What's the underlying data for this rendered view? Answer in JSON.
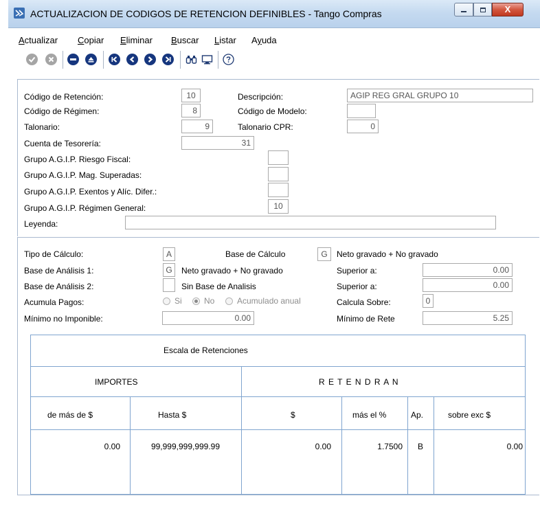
{
  "window": {
    "title": "ACTUALIZACION DE CODIGOS DE RETENCION DEFINIBLES - Tango Compras",
    "minimize_icon": "minimize-icon",
    "maximize_icon": "maximize-icon",
    "close_label": "X"
  },
  "menu": [
    {
      "accel": "A",
      "rest": "ctualizar"
    },
    {
      "accel": "C",
      "rest": "opiar"
    },
    {
      "accel": "E",
      "rest": "liminar"
    },
    {
      "accel": "B",
      "rest": "uscar"
    },
    {
      "accel": "L",
      "rest": "istar"
    },
    {
      "pre": "A",
      "accel": "y",
      "rest": "uda"
    }
  ],
  "toolbar": {
    "icons": [
      "accept-icon",
      "cancel-icon",
      "delete-icon",
      "eject-icon",
      "first-record-icon",
      "previous-record-icon",
      "next-record-icon",
      "last-record-icon",
      "binoculars-search-icon",
      "monitor-icon",
      "help-icon"
    ],
    "colors": {
      "disabled": "#a5a5a5",
      "active": "#16367e"
    }
  },
  "form": {
    "codigo_retencion": {
      "label": "Código de Retención:",
      "value": "10"
    },
    "codigo_regimen": {
      "label": "Código de Régimen:",
      "value": "8"
    },
    "talonario": {
      "label": "Talonario:",
      "value": "9"
    },
    "cuenta_tesoreria": {
      "label": "Cuenta de Tesorería:",
      "value": "31"
    },
    "grupo_riesgo": {
      "label": "Grupo A.G.I.P. Riesgo Fiscal:",
      "value": ""
    },
    "grupo_mag": {
      "label": "Grupo A.G.I.P. Mag. Superadas:",
      "value": ""
    },
    "grupo_exentos": {
      "label": "Grupo A.G.I.P. Exentos y Alíc. Difer.:",
      "value": ""
    },
    "grupo_general": {
      "label": "Grupo A.G.I.P. Régimen General:",
      "value": "10"
    },
    "leyenda": {
      "label": "Leyenda:",
      "value": ""
    },
    "descripcion": {
      "label": "Descripción:",
      "value": "AGIP REG GRAL GRUPO 10"
    },
    "codigo_modelo": {
      "label": "Código de Modelo:",
      "value": ""
    },
    "talonario_cpr": {
      "label": "Talonario CPR:",
      "value": "0"
    }
  },
  "calc": {
    "tipo_calculo": {
      "label": "Tipo de Cálculo:",
      "value": "A"
    },
    "base_calculo": {
      "label": "Base de Cálculo",
      "value": "G",
      "desc": "Neto gravado + No gravado"
    },
    "base_analisis_1": {
      "label": "Base de Análisis 1:",
      "value": "G",
      "desc": "Neto gravado + No gravado"
    },
    "base_analisis_2": {
      "label": "Base de Análisis 2:",
      "value": "",
      "desc": "Sin Base de Analisis"
    },
    "acumula_pagos": {
      "label": "Acumula Pagos:",
      "options": [
        "Si",
        "No",
        "Acumulado anual"
      ],
      "selected": "No"
    },
    "minimo_no_imponible": {
      "label": "Mínimo no Imponible:",
      "value": "0.00"
    },
    "superior_a_1": {
      "label": "Superior a:",
      "value": "0.00"
    },
    "superior_a_2": {
      "label": "Superior a:",
      "value": "0.00"
    },
    "calcula_sobre": {
      "label": "Calcula Sobre:",
      "value": "0"
    },
    "minimo_rete": {
      "label": "Mínimo de Rete",
      "value": "5.25"
    }
  },
  "escala": {
    "title": "Escala de Retenciones",
    "group_importes": "IMPORTES",
    "group_retendran": "R E T E N D R A N",
    "columns": [
      "de más de $",
      "Hasta $",
      "$",
      "más el %",
      "Ap.",
      "sobre exc $"
    ],
    "rows": [
      [
        "0.00",
        "99,999,999,999.99",
        "0.00",
        "1.7500",
        "B",
        "0.00"
      ]
    ]
  }
}
